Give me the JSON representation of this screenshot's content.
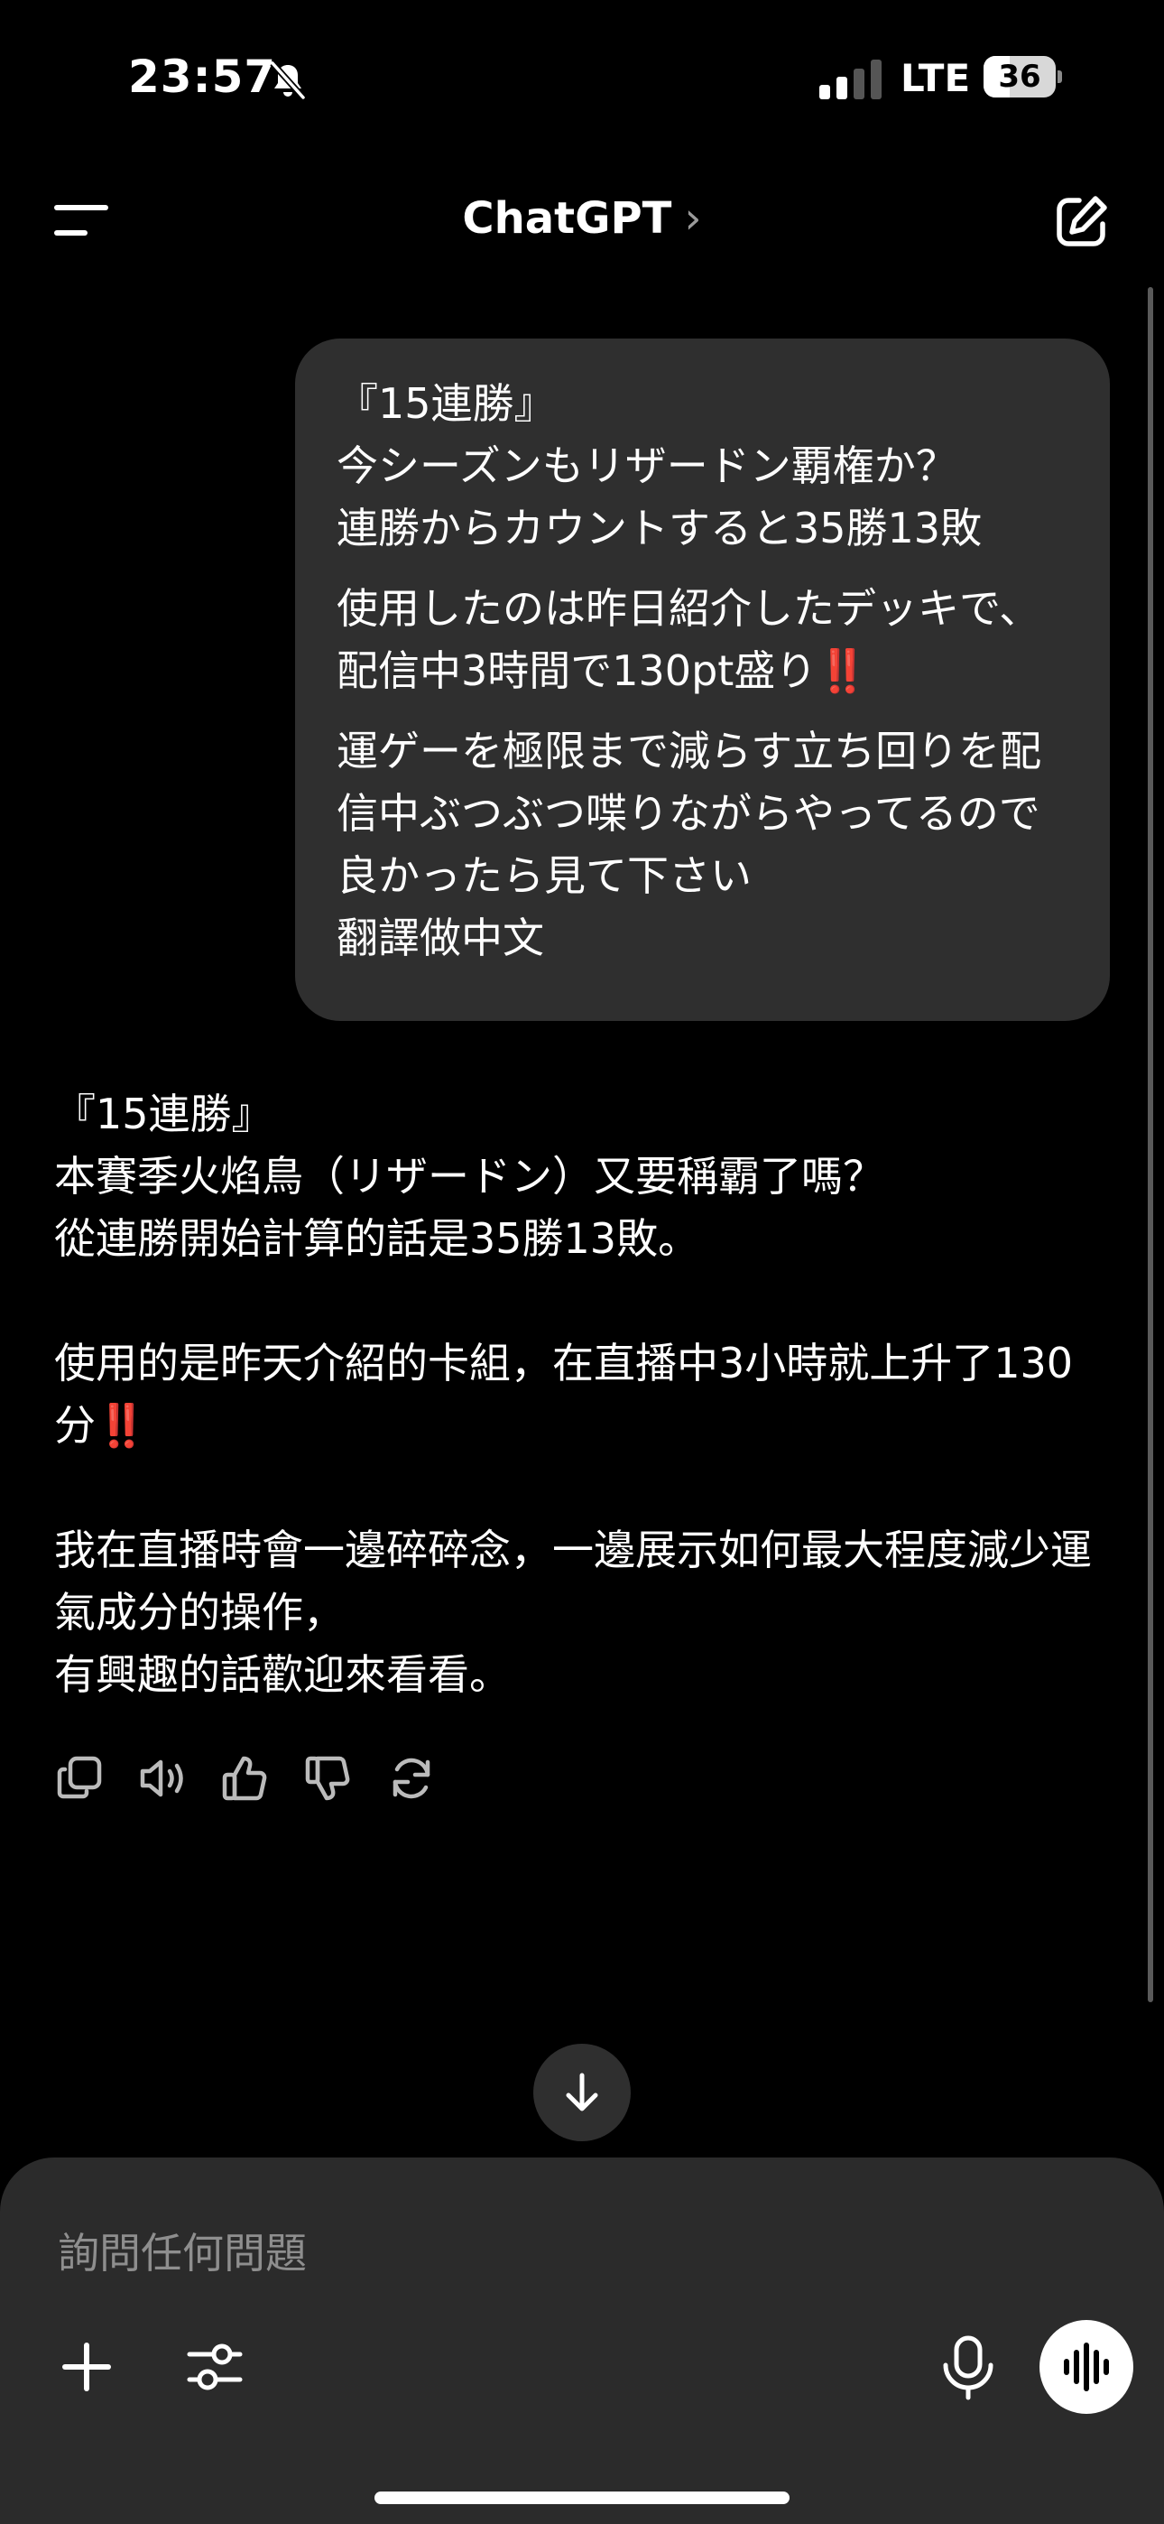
{
  "status_bar": {
    "time": "23:57",
    "network": "LTE",
    "battery_level": "36",
    "battery_fraction": 0.36,
    "icons": [
      "bell-off-icon",
      "signal-icon",
      "battery-icon"
    ]
  },
  "header": {
    "title": "ChatGPT",
    "chevron": "›",
    "icons": [
      "menu-icon",
      "chevron-right-icon",
      "new-chat-edit-icon"
    ]
  },
  "conversation": {
    "user_message": {
      "paragraphs": [
        "『15連勝』\n今シーズンもリザードン覇権か？\n連勝からカウントすると35勝13敗",
        "使用したのは昨日紹介したデッキで、配信中3時間で130pt盛り",
        "運ゲーを極限まで減らす立ち回りを配信中ぶつぶつ喋りながらやってるので良かったら見て下さい\n翻譯做中文"
      ],
      "emoji": "‼️"
    },
    "assistant_message": {
      "paragraphs": [
        "『15連勝』\n本賽季火焰鳥（リザードン）又要稱霸了嗎？\n從連勝開始計算的話是35勝13敗。",
        "使用的是昨天介紹的卡組，在直播中3小時就上升了130分",
        "我在直播時會一邊碎碎念，一邊展示如何最大程度減少運氣成分的操作，\n有興趣的話歡迎來看看。"
      ],
      "emoji": "‼️"
    },
    "actions": [
      "copy-icon",
      "read-aloud-icon",
      "thumbs-up-icon",
      "thumbs-down-icon",
      "regenerate-icon"
    ]
  },
  "composer": {
    "placeholder": "詢問任何問題",
    "icons": [
      "plus-icon",
      "tools-icon",
      "microphone-icon",
      "voice-mode-icon"
    ]
  },
  "colors": {
    "background": "#000000",
    "bubble": "#2f2f2f",
    "composer": "#2b2b2b",
    "placeholder": "#8e8e8e",
    "emoji_red": "#e2262d"
  }
}
